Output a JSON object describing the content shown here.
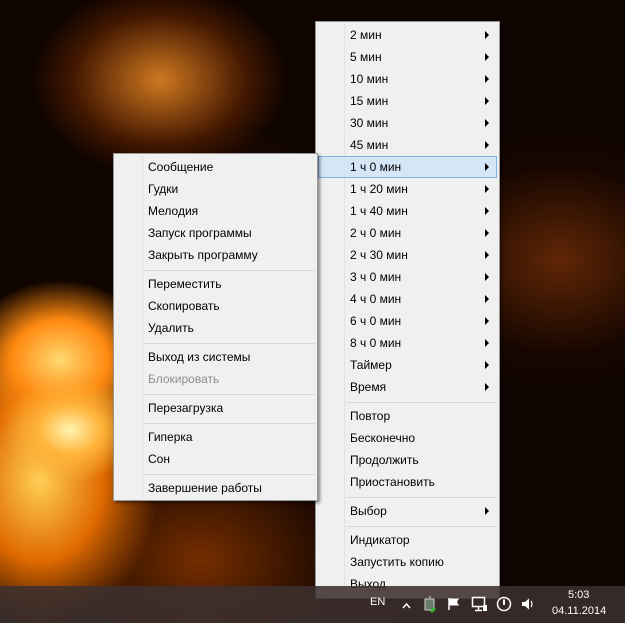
{
  "context_menu": {
    "items": [
      "Сообщение",
      "Гудки",
      "Мелодия",
      "Запуск программы",
      "Закрыть программу",
      "Переместить",
      "Скопировать",
      "Удалить",
      "Выход из системы",
      "Блокировать",
      "Перезагрузка",
      "Гиперка",
      "Сон",
      "Завершение работы"
    ],
    "disabled_item": "Блокировать"
  },
  "time_menu": {
    "items": [
      "2 мин",
      "5 мин",
      "10 мин",
      "15 мин",
      "30 мин",
      "45 мин",
      "1 ч 0 мин",
      "1 ч 20 мин",
      "1 ч 40 мин",
      "2 ч 0 мин",
      "2 ч 30 мин",
      "3 ч 0 мин",
      "4 ч 0 мин",
      "6 ч 0 мин",
      "8 ч 0 мин",
      "Таймер",
      "Время",
      "Повтор",
      "Бесконечно",
      "Продолжить",
      "Приостановить",
      "Выбор",
      "Индикатор",
      "Запустить копию",
      "Выход"
    ],
    "highlighted_item": "1 ч 0 мин"
  },
  "taskbar": {
    "language": "EN",
    "time": "5:03",
    "date": "04.11.2014",
    "tray_icons": [
      "chevron-up-icon",
      "power-app-icon",
      "flag-icon",
      "network-icon",
      "power-icon",
      "volume-icon"
    ]
  },
  "colors": {
    "menu_bg": "#f0f0f0",
    "highlight_bg": "#d5e6f7",
    "highlight_border": "#7fb2e5",
    "disabled_text": "#8d8d8d"
  }
}
